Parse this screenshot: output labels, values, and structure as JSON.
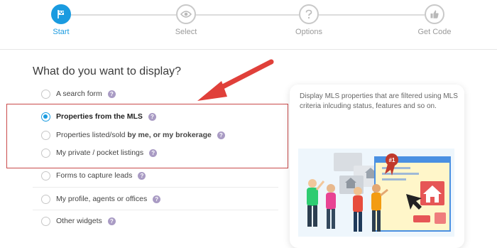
{
  "stepper": {
    "steps": [
      {
        "label": "Start",
        "icon": "flag-icon",
        "active": true
      },
      {
        "label": "Select",
        "icon": "eye-icon",
        "active": false
      },
      {
        "label": "Options",
        "icon": "question-icon",
        "active": false
      },
      {
        "label": "Get Code",
        "icon": "thumbs-up-icon",
        "active": false
      }
    ]
  },
  "main": {
    "question": "What do you want to display?",
    "options": [
      {
        "label": "A search form",
        "checked": false,
        "bold": false
      },
      {
        "label": "Properties from the MLS",
        "checked": true,
        "bold": true
      },
      {
        "label_pre": "Properties listed/sold ",
        "label_bold": "by me, or my brokerage",
        "checked": false
      },
      {
        "label": "My private / pocket listings",
        "checked": false,
        "bold": false
      },
      {
        "label": "Forms to capture leads",
        "checked": false,
        "bold": false
      },
      {
        "label": "My profile, agents or offices",
        "checked": false,
        "bold": false
      },
      {
        "label": "Other widgets",
        "checked": false,
        "bold": false
      }
    ],
    "help_glyph": "?"
  },
  "card": {
    "description": "Display MLS properties that are filtered using MLS criteria inlcuding status, features and so on.",
    "badge_text": "#1"
  },
  "colors": {
    "accent": "#1a9be0",
    "highlight": "#c94a4a",
    "arrow": "#e0403a",
    "help": "#a99bc4"
  }
}
